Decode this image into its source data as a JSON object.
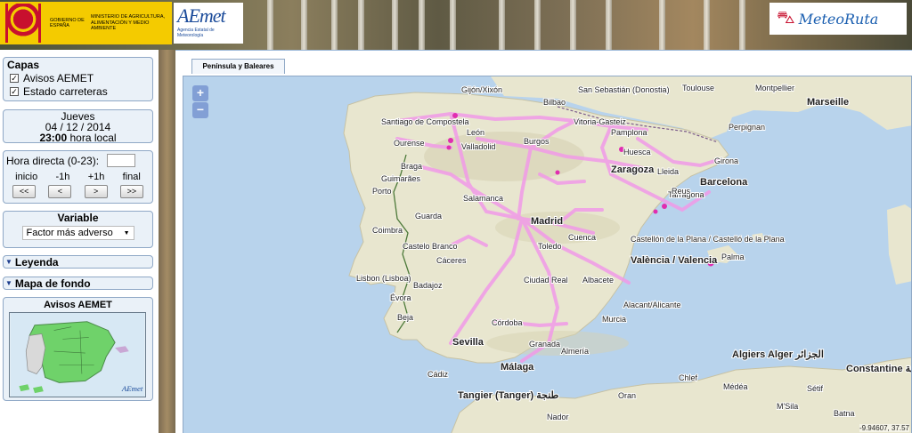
{
  "header": {
    "gov_line1": "GOBIERNO DE ESPAÑA",
    "ministry": "MINISTERIO DE AGRICULTURA, ALIMENTACIÓN Y MEDIO AMBIENTE",
    "aemet_word": "AEmet",
    "aemet_sub": "Agencia Estatal de Meteorología",
    "meteoruta_word": "MeteoRuta"
  },
  "sidebar": {
    "capas": {
      "title": "Capas",
      "items": [
        {
          "label": "Avisos AEMET",
          "checked": true
        },
        {
          "label": "Estado carreteras",
          "checked": true
        }
      ]
    },
    "fecha": {
      "weekday": "Jueves",
      "date": "04 / 12 / 2014",
      "time": "23:00",
      "time_suffix": "hora local"
    },
    "hora": {
      "label": "Hora directa (0-23):",
      "input_value": "",
      "step_labels": [
        "inicio",
        "-1h",
        "+1h",
        "final"
      ],
      "buttons": [
        "<<",
        "<",
        ">",
        ">>"
      ]
    },
    "variable": {
      "title": "Variable",
      "selected": "Factor más adverso",
      "arrow": "▼"
    },
    "leyenda": "Leyenda",
    "mapa_fondo": "Mapa de fondo",
    "avisos": {
      "title": "Avisos AEMET",
      "logo": "AEmet"
    }
  },
  "main": {
    "tab": "Península y Baleares",
    "zoom_in": "+",
    "zoom_out": "−",
    "coords": "-9.94607, 37.57"
  },
  "colors": {
    "road_overlay": "#f19ae8",
    "sea": "#b8d3ec",
    "land": "#e8e6cf",
    "panel": "#eaf1f8",
    "avisos_green": "#6fd26a"
  },
  "places": [
    "Gijón/Xixón",
    "Bilbao",
    "San Sebastián (Donostia)",
    "Toulouse",
    "Montpellier",
    "Marseille",
    "Santiago de Compostela",
    "León",
    "Burgos",
    "Vitoria-Gasteiz",
    "Pamplona",
    "Perpignan",
    "Ourense",
    "Braga",
    "Valladolid",
    "Huesca",
    "Zaragoza",
    "Lleida",
    "Girona",
    "Barcelona",
    "Guimarães",
    "Porto",
    "Salamanca",
    "Madrid",
    "Tarragona",
    "Reus",
    "Coimbra",
    "Guarda",
    "Castelo Branco",
    "Cuenca",
    "Toledo",
    "Castellón de la Plana / Castelló de la Plana",
    "Cáceres",
    "València / Valencia",
    "Palma",
    "Lisbon (Lisboa)",
    "Badajoz",
    "Ciudad Real",
    "Albacete",
    "Alacant/Alicante",
    "Évora",
    "Beja",
    "Córdoba",
    "Murcia",
    "Sevilla",
    "Almería",
    "Málaga",
    "Granada",
    "Algiers Alger الجزائر",
    "Cádiz",
    "Tangier (Tanger) طنجة",
    "Chlef",
    "Médéa",
    "Sétif",
    "Constantine قسنطينة",
    "Oran",
    "Nador",
    "Batna",
    "M'Sila"
  ]
}
